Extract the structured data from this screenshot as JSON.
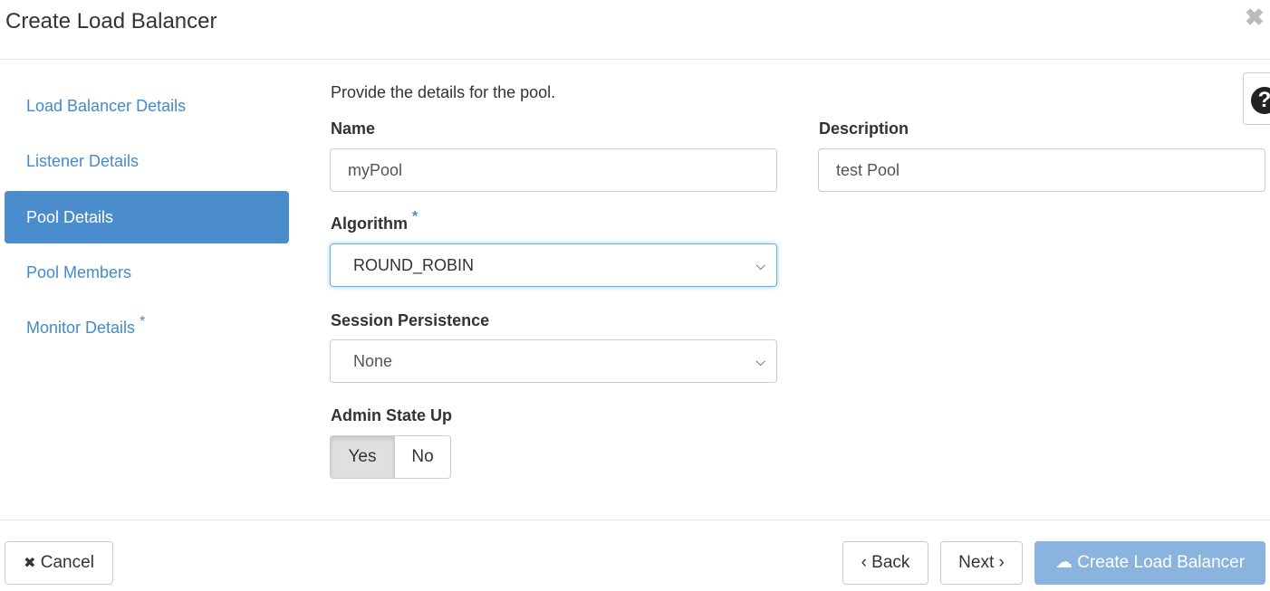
{
  "dialog": {
    "title": "Create Load Balancer",
    "close_icon": "close-icon"
  },
  "sidebar": {
    "items": [
      {
        "label": "Load Balancer Details"
      },
      {
        "label": "Listener Details"
      },
      {
        "label": "Pool Details",
        "active": true
      },
      {
        "label": "Pool Members"
      },
      {
        "label": "Monitor Details",
        "required": "*"
      }
    ]
  },
  "form": {
    "intro": "Provide the details for the pool.",
    "name_label": "Name",
    "name_value": "myPool",
    "description_label": "Description",
    "description_value": "test Pool",
    "algorithm_label": "Algorithm",
    "algorithm_required": "*",
    "algorithm_value": "ROUND_ROBIN",
    "session_label": "Session Persistence",
    "session_value": "None",
    "admin_label": "Admin State Up",
    "admin_yes": "Yes",
    "admin_no": "No",
    "admin_selected": "Yes"
  },
  "footer": {
    "cancel": "Cancel",
    "back": "Back",
    "next": "Next",
    "create": "Create Load Balancer"
  },
  "colors": {
    "accent": "#428bca",
    "active_nav": "#4a8ccc",
    "create_disabled": "#8ab4dd"
  }
}
